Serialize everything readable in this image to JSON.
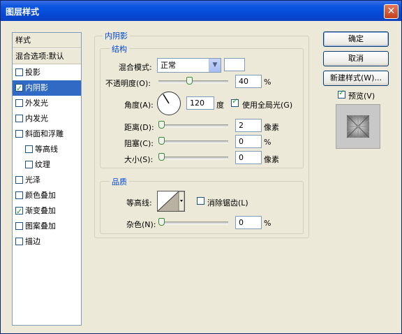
{
  "window": {
    "title": "图层样式"
  },
  "stylelist": {
    "header": "样式",
    "blend_options": "混合选项:默认",
    "items": [
      {
        "label": "投影",
        "checked": false,
        "selected": false
      },
      {
        "label": "内阴影",
        "checked": true,
        "selected": true
      },
      {
        "label": "外发光",
        "checked": false,
        "selected": false
      },
      {
        "label": "内发光",
        "checked": false,
        "selected": false
      },
      {
        "label": "斜面和浮雕",
        "checked": false,
        "selected": false
      },
      {
        "label": "等高线",
        "checked": false,
        "selected": false
      },
      {
        "label": "纹理",
        "checked": false,
        "selected": false
      },
      {
        "label": "光泽",
        "checked": false,
        "selected": false
      },
      {
        "label": "颜色叠加",
        "checked": false,
        "selected": false
      },
      {
        "label": "渐变叠加",
        "checked": true,
        "selected": false
      },
      {
        "label": "图案叠加",
        "checked": false,
        "selected": false
      },
      {
        "label": "描边",
        "checked": false,
        "selected": false
      }
    ]
  },
  "panel": {
    "title": "内阴影",
    "structure": {
      "title": "结构",
      "blend_mode_label": "混合模式:",
      "blend_mode_value": "正常",
      "opacity_label": "不透明度(O):",
      "opacity_value": "40",
      "opacity_fraction": 0.4,
      "percent": "%",
      "angle_label": "角度(A):",
      "angle_value": "120",
      "angle_unit": "度",
      "global_light_label": "使用全局光(G)",
      "global_light_checked": true,
      "distance_label": "距离(D):",
      "distance_value": "2",
      "distance_unit": "像素",
      "choke_label": "阻塞(C):",
      "choke_value": "0",
      "choke_unit": "%",
      "size_label": "大小(S):",
      "size_value": "0",
      "size_unit": "像素"
    },
    "quality": {
      "title": "品质",
      "contour_label": "等高线:",
      "anti_alias_label": "消除锯齿(L)",
      "anti_alias_checked": false,
      "noise_label": "杂色(N):",
      "noise_value": "0",
      "noise_unit": "%"
    }
  },
  "buttons": {
    "ok": "确定",
    "cancel": "取消",
    "new_style": "新建样式(W)...",
    "preview_label": "预览(V)",
    "preview_checked": true
  },
  "colors": {
    "accent": "#0046d5",
    "selection": "#316ac5",
    "titlebar": "#0548d4"
  }
}
